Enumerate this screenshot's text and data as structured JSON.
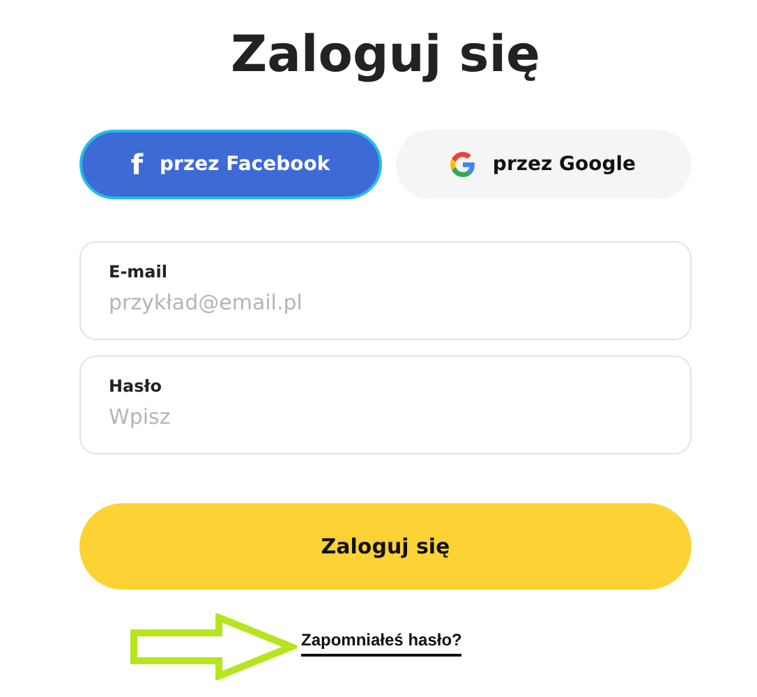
{
  "title": "Zaloguj się",
  "social_buttons": [
    {
      "kind": "facebook",
      "icon": "f",
      "label": "przez Facebook"
    },
    {
      "kind": "google",
      "label": "przez Google"
    }
  ],
  "fields": [
    {
      "label": "E-mail",
      "placeholder": "przykład@email.pl"
    },
    {
      "label": "Hasło",
      "placeholder": "Wpisz"
    }
  ],
  "submit": "Zaloguj się",
  "forgot_link": "Zapomniałeś hasło?"
}
